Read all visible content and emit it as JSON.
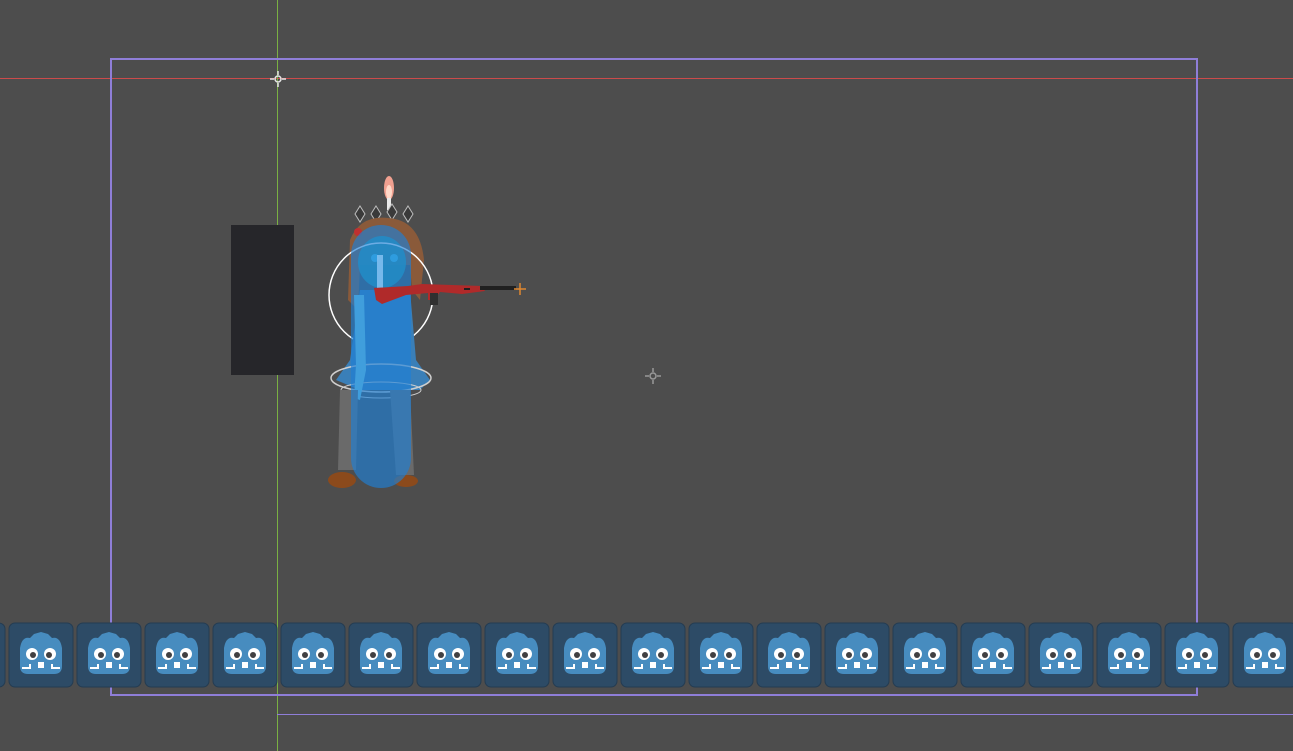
{
  "scene": {
    "background": "#4d4d4d",
    "axis_x_color": "#cc4b4b",
    "axis_y_color": "#7ab043",
    "camera_color": "#8f7ed8",
    "tile_color": "#2d4b66",
    "tile_icon_color": "#478cbf",
    "collision_shape_color": "#1f7fd6",
    "block_color": "#26262a",
    "tile_count": 20
  },
  "nodes": {
    "player": {
      "icon": "anime-girl-sprite"
    },
    "weapon": {
      "icon": "red-rifle-sprite"
    },
    "origin_marker": {
      "icon": "crosshair-icon"
    },
    "center_marker": {
      "icon": "crosshair-icon"
    },
    "tile": {
      "icon": "godot-logo-icon"
    }
  }
}
